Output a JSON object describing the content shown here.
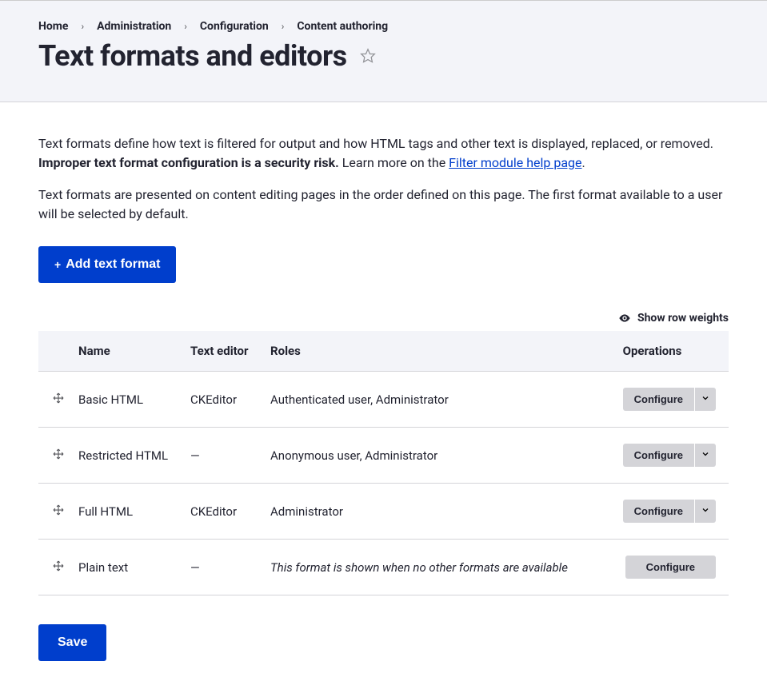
{
  "breadcrumb": {
    "home": "Home",
    "admin": "Administration",
    "config": "Configuration",
    "content": "Content authoring"
  },
  "page_title": "Text formats and editors",
  "intro": {
    "p1_a": "Text formats define how text is filtered for output and how HTML tags and other text is displayed, replaced, or removed. ",
    "p1_b_strong": "Improper text format configuration is a security risk.",
    "p1_c": " Learn more on the ",
    "p1_link": "Filter module help page",
    "p1_d": ".",
    "p2": "Text formats are presented on content editing pages in the order defined on this page. The first format available to a user will be selected by default."
  },
  "buttons": {
    "add": "Add text format",
    "show_weights": "Show row weights",
    "configure": "Configure",
    "save": "Save"
  },
  "table": {
    "headers": {
      "name": "Name",
      "editor": "Text editor",
      "roles": "Roles",
      "ops": "Operations"
    },
    "rows": [
      {
        "name": "Basic HTML",
        "editor": "CKEditor",
        "roles": "Authenticated user, Administrator",
        "italic": false,
        "has_caret": true
      },
      {
        "name": "Restricted HTML",
        "editor": "—",
        "roles": "Anonymous user, Administrator",
        "italic": false,
        "has_caret": true
      },
      {
        "name": "Full HTML",
        "editor": "CKEditor",
        "roles": "Administrator",
        "italic": false,
        "has_caret": true
      },
      {
        "name": "Plain text",
        "editor": "—",
        "roles": "This format is shown when no other formats are available",
        "italic": true,
        "has_caret": false
      }
    ]
  }
}
